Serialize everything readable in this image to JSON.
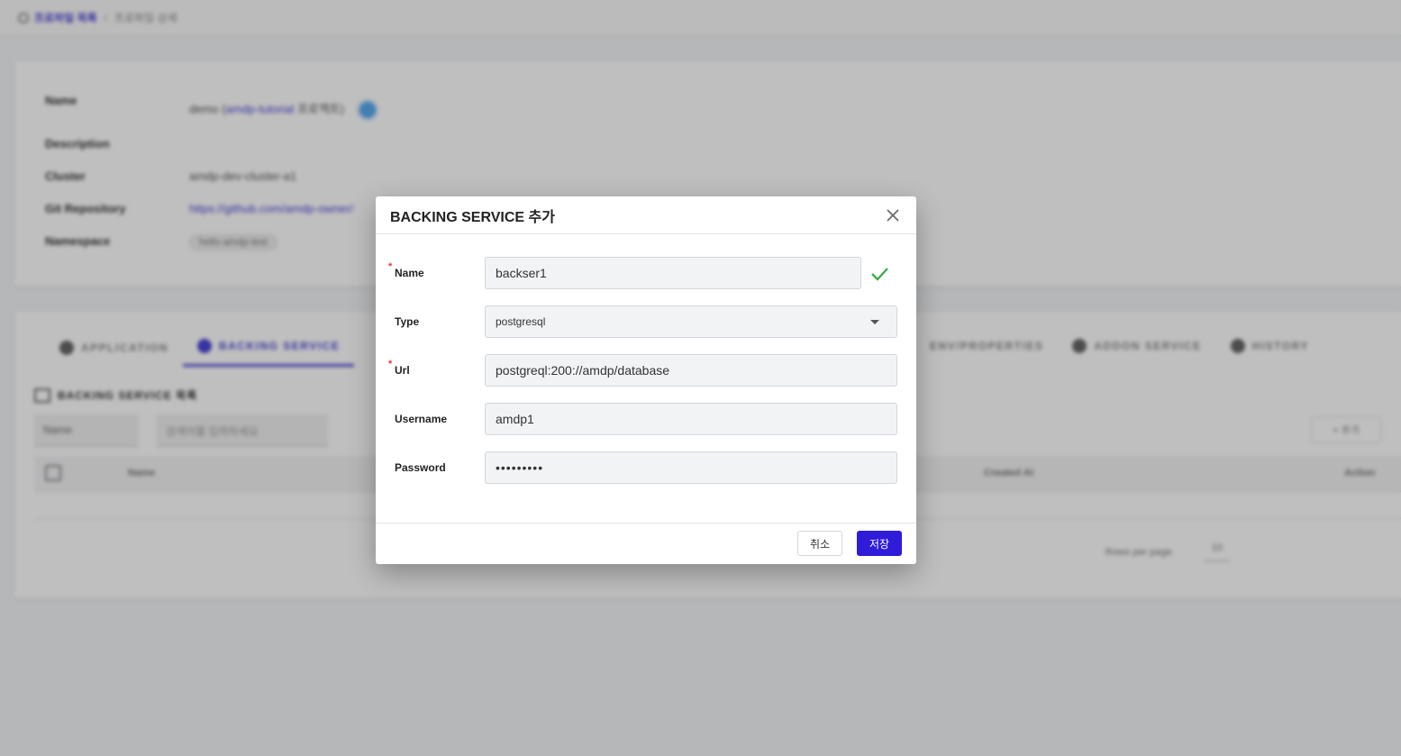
{
  "breadcrumb": {
    "link_label": "프로파일 목록",
    "separator": "/",
    "current_label": "프로파일 상세"
  },
  "profile": {
    "name_label": "Name",
    "name_prefix": "demo (",
    "name_project": "amdp-tutorial",
    "name_suffix": " 프로젝트)",
    "description_label": "Description",
    "description_value": "",
    "cluster_label": "Cluster",
    "cluster_value": "amdp-dev-cluster-a1",
    "repo_label": "Git Repository",
    "repo_value": "https://github.com/amdp-owner/",
    "namespace_label": "Namespace",
    "namespace_value": "hello-amdp-test"
  },
  "tabs": [
    {
      "label": "APPLICATION",
      "active": false
    },
    {
      "label": "BACKING SERVICE",
      "active": true
    }
  ],
  "tabs_right": [
    {
      "label": "ENV/PROPERTIES"
    },
    {
      "label": "ADDON SERVICE"
    },
    {
      "label": "HISTORY"
    }
  ],
  "list": {
    "title": "BACKING SERVICE 목록",
    "filter_select": "Name",
    "search_placeholder": "검색어를 입력하세요",
    "add_label": "+ 추가",
    "columns": {
      "name": "Name",
      "created_at": "Created At",
      "action": "Action"
    },
    "rows_per_page_label": "Rows per page",
    "rows_per_page_value": "10"
  },
  "dialog": {
    "title": "BACKING SERVICE 추가",
    "fields": {
      "name": {
        "label": "Name",
        "value": "backser1",
        "required": true,
        "valid": true
      },
      "type": {
        "label": "Type",
        "value": "postgresql"
      },
      "url": {
        "label": "Url",
        "value": "postgreql:200://amdp/database",
        "required": true
      },
      "username": {
        "label": "Username",
        "value": "amdp1"
      },
      "password": {
        "label": "Password",
        "value": "•••••••••"
      }
    },
    "required_mark": "*",
    "cancel_label": "취소",
    "save_label": "저장"
  },
  "colors": {
    "accent": "#2f1cd9",
    "link": "#4b44d6",
    "valid_check": "#3dae4a",
    "required": "#e23b3b"
  },
  "icons": [
    "close-icon",
    "check-icon",
    "chevron-down-icon"
  ]
}
